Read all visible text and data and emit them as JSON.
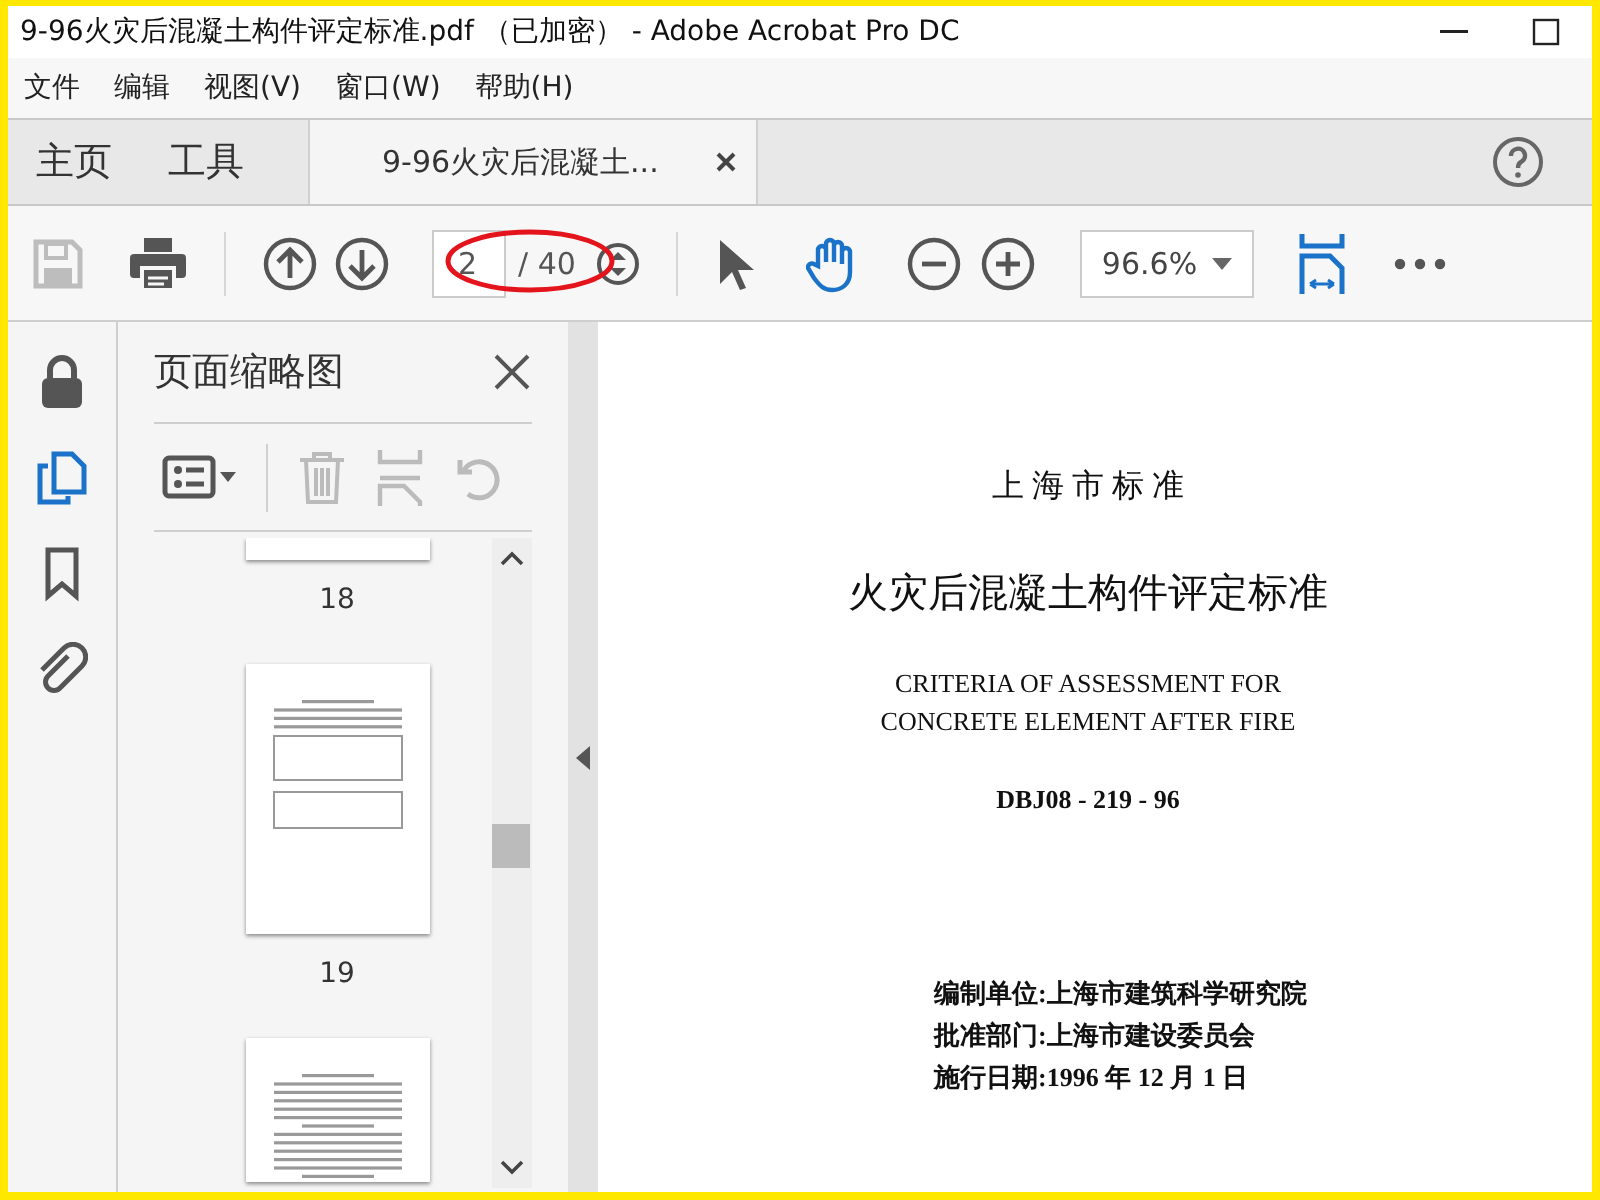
{
  "window": {
    "title": "9-96火灾后混凝土构件评定标准.pdf （已加密） - Adobe Acrobat Pro DC"
  },
  "menu": [
    {
      "label": "文件"
    },
    {
      "label": "编辑"
    },
    {
      "label": "视图(V)"
    },
    {
      "label": "窗口(W)"
    },
    {
      "label": "帮助(H)"
    }
  ],
  "nav_tabs": [
    {
      "label": "主页",
      "selected": false
    },
    {
      "label": "工具",
      "selected": false
    }
  ],
  "document_tabs": [
    {
      "label": "9-96火灾后混凝土...",
      "selected": true
    }
  ],
  "toolbar": {
    "page_number": "2",
    "page_count": "/ 40",
    "zoom": "96.6%",
    "save_disabled": true
  },
  "side_panel": {
    "title": "页面缩略图",
    "thumbnails": [
      {
        "kind": "cut-top",
        "label": "18"
      },
      {
        "kind": "whole",
        "label": "19"
      },
      {
        "kind": "cut-bottom"
      }
    ]
  },
  "document": {
    "lines": [
      {
        "kind": "spaced-heading",
        "text": "上 海 市 标 准"
      },
      {
        "kind": "title",
        "text": "火灾后混凝土构件评定标准"
      },
      {
        "kind": "english",
        "text": "CRITERIA OF ASSESSMENT FOR"
      },
      {
        "kind": "english",
        "text": "CONCRETE ELEMENT AFTER FIRE"
      },
      {
        "kind": "code",
        "text": "DBJ08 - 219 - 96"
      },
      {
        "kind": "info",
        "text": "编制单位:上海市建筑科学研究院"
      },
      {
        "kind": "info",
        "text": "批准部门:上海市建设委员会"
      },
      {
        "kind": "info",
        "text": "施行日期:1996 年 12 月 1 日"
      }
    ]
  }
}
